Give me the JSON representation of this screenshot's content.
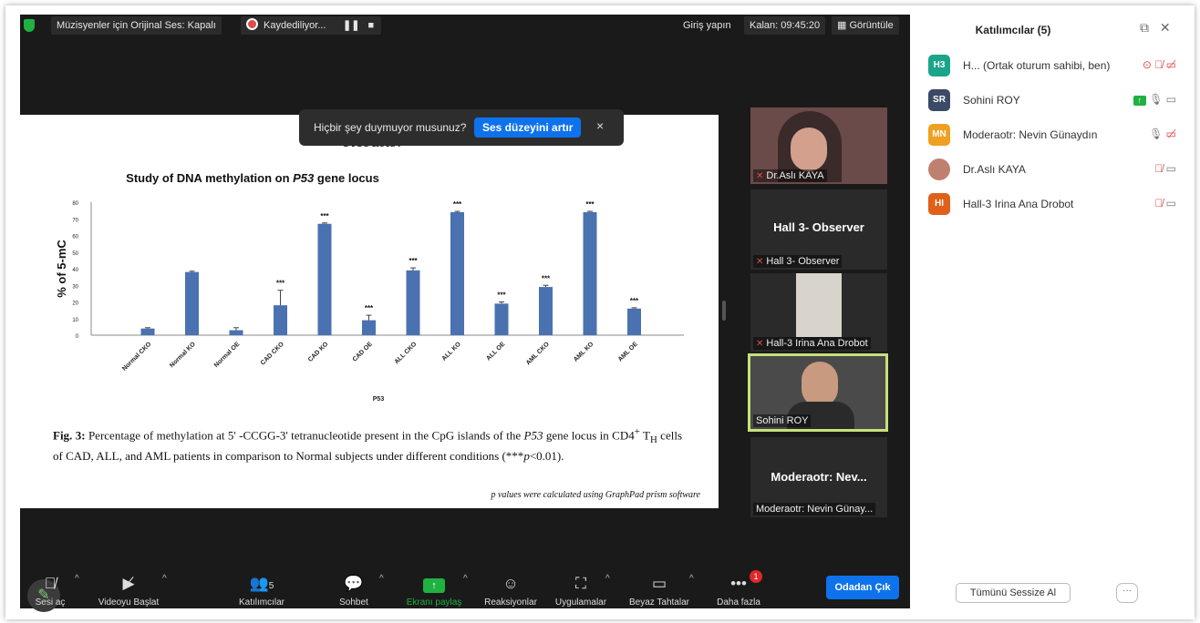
{
  "topbar": {
    "audio_label": "Müzisyenler için Orijinal Ses: Kapalı",
    "recording_label": "Kaydediliyor...",
    "pause_icon": "pause-icon",
    "stop_icon": "stop-icon",
    "signin_label": "Giriş yapın",
    "timer_label": "Kalan: 09:45:20",
    "view_label": "Görüntüle"
  },
  "toast": {
    "message": "Hiçbir şey duymuyor musunuz?",
    "button_label": "Ses düzeyini artır",
    "close_glyph": "×"
  },
  "slide": {
    "heading": "Results:",
    "caption_parts": {
      "fig": "Fig. 3:",
      "text1": " Percentage of methylation at 5' -CCGG-3' tetranucleotide present in the CpG islands of the ",
      "gene": "P53",
      "text2": " gene locus in CD4",
      "sup": "+",
      "text3": " T",
      "sub": "H",
      "text4": " cells of CAD, ALL, and AML patients in comparison to Normal subjects under different conditions (***",
      "p": "p",
      "text5": "<0.01)."
    },
    "footnote": "p values were calculated using GraphPad prism software"
  },
  "chart_data": {
    "type": "bar",
    "title_parts": {
      "pre": "Study of DNA methylation on ",
      "italic": "P53",
      "post": " gene locus"
    },
    "xlabel": "P53",
    "ylabel": "% of 5-mC",
    "ylim": [
      0,
      80
    ],
    "yticks": [
      0,
      10,
      20,
      30,
      40,
      50,
      60,
      70,
      80
    ],
    "categories": [
      "Normal CKO",
      "Normal KO",
      "Normal OE",
      "CAD CKO",
      "CAD KO",
      "CAD OE",
      "ALL CKO",
      "ALL KO",
      "ALL OE",
      "AML CKO",
      "AML KO",
      "AML OE"
    ],
    "values": [
      4,
      38,
      3,
      18,
      67,
      9,
      39,
      74,
      19,
      29,
      74,
      16
    ],
    "errors": [
      0.5,
      0.5,
      1.5,
      9,
      0.5,
      3,
      1.5,
      0.5,
      1,
      1,
      0.5,
      0.5
    ],
    "significance": [
      "",
      "",
      "",
      "***",
      "***",
      "***",
      "***",
      "***",
      "***",
      "***",
      "***",
      "***"
    ],
    "bar_color": "#4a72b0"
  },
  "videos": {
    "tile1_name": "Dr.Aslı KAYA",
    "tile2_center": "Hall 3- Observer",
    "tile2_name": "Hall 3- Observer",
    "tile3_name": "Hall-3 Irina Ana Drobot",
    "tile4_name": "Sohini ROY",
    "tile5_center": "Moderaotr:  Nev...",
    "tile5_name": "Moderaotr: Nevin Günay..."
  },
  "toolbar": {
    "mute_label": "Sesi aç",
    "video_label": "Videoyu Başlat",
    "participants_label": "Katılımcılar",
    "participants_count": "5",
    "chat_label": "Sohbet",
    "share_label": "Ekranı paylaş",
    "reactions_label": "Reaksiyonlar",
    "apps_label": "Uygulamalar",
    "whiteboard_label": "Beyaz Tahtalar",
    "more_label": "Daha fazla",
    "more_badge": "1",
    "leave_label": "Odadan Çık"
  },
  "panel": {
    "title": "Katılımcılar (5)",
    "participants": [
      {
        "initials": "H3",
        "name": "H... (Ortak oturum sahibi, ben)",
        "color": "#1aa58a"
      },
      {
        "initials": "SR",
        "name": "Sohini ROY",
        "color": "#3b4a66"
      },
      {
        "initials": "MN",
        "name": "Moderaotr: Nevin Günaydın",
        "color": "#f0a020"
      },
      {
        "initials": "",
        "name": "Dr.Aslı KAYA",
        "color": "#c08070"
      },
      {
        "initials": "HI",
        "name": "Hall-3 Irina Ana Drobot",
        "color": "#e0601a"
      }
    ],
    "mute_all_label": "Tümünü Sessize Al",
    "more_glyph": "···"
  },
  "colors": {
    "accent": "#0e72ed",
    "meeting_bg": "#1a1a1a",
    "danger": "#e04a4a",
    "active_speaker": "#c8e07a"
  }
}
